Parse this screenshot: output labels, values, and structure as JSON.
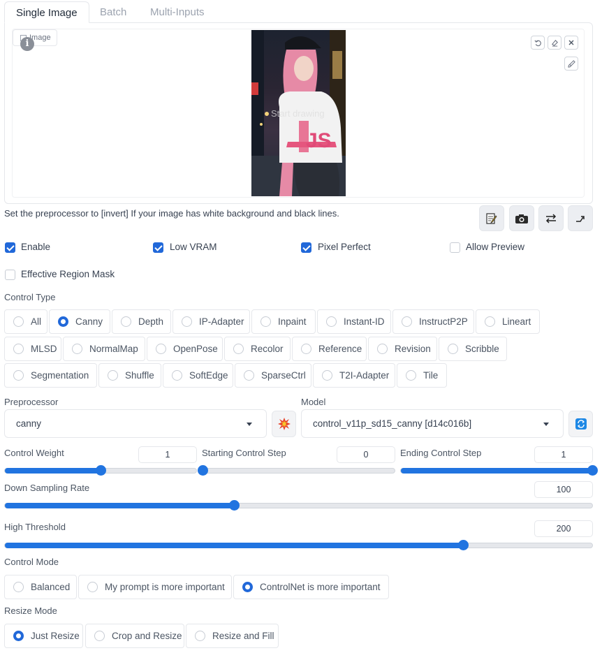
{
  "tabs": [
    {
      "label": "Single Image",
      "active": true
    },
    {
      "label": "Batch",
      "active": false
    },
    {
      "label": "Multi-Inputs",
      "active": false
    }
  ],
  "image_panel": {
    "image_label": "Image",
    "overlay_text": "Start drawing",
    "image_caption_letters": "JS"
  },
  "hint": "Set the preprocessor to [invert] If your image has white background and black lines.",
  "checkboxes": [
    {
      "label": "Enable",
      "checked": true
    },
    {
      "label": "Low VRAM",
      "checked": true
    },
    {
      "label": "Pixel Perfect",
      "checked": true
    },
    {
      "label": "Allow Preview",
      "checked": false
    },
    {
      "label": "Effective Region Mask",
      "checked": false
    }
  ],
  "control_type": {
    "label": "Control Type",
    "options": [
      "All",
      "Canny",
      "Depth",
      "IP-Adapter",
      "Inpaint",
      "Instant-ID",
      "InstructP2P",
      "Lineart",
      "MLSD",
      "NormalMap",
      "OpenPose",
      "Recolor",
      "Reference",
      "Revision",
      "Scribble",
      "Segmentation",
      "Shuffle",
      "SoftEdge",
      "SparseCtrl",
      "T2I-Adapter",
      "Tile"
    ],
    "selected": "Canny"
  },
  "preprocessor": {
    "label": "Preprocessor",
    "value": "canny"
  },
  "model": {
    "label": "Model",
    "value": "control_v11p_sd15_canny [d14c016b]"
  },
  "sliders": {
    "control_weight": {
      "label": "Control Weight",
      "value": "1",
      "fraction": 0.5
    },
    "starting_step": {
      "label": "Starting Control Step",
      "value": "0",
      "fraction": 0.0
    },
    "ending_step": {
      "label": "Ending Control Step",
      "value": "1",
      "fraction": 1.0
    },
    "down_sampling": {
      "label": "Down Sampling Rate",
      "value": "100",
      "fraction": 0.39
    },
    "high_threshold": {
      "label": "High Threshold",
      "value": "200",
      "fraction": 0.78
    }
  },
  "control_mode": {
    "label": "Control Mode",
    "options": [
      "Balanced",
      "My prompt is more important",
      "ControlNet is more important"
    ],
    "selected": "ControlNet is more important"
  },
  "resize_mode": {
    "label": "Resize Mode",
    "options": [
      "Just Resize",
      "Crop and Resize",
      "Resize and Fill"
    ],
    "selected": "Just Resize"
  },
  "colors": {
    "accent": "#2174e0",
    "checkbox": "#2168d9",
    "border": "#e5e7eb"
  },
  "icons": [
    "info-icon",
    "image-icon",
    "undo-icon",
    "eraser-icon",
    "close-icon",
    "brush-icon",
    "edit-canvas-icon",
    "camera-icon",
    "swap-icon",
    "send-dimensions-icon",
    "explosion-icon",
    "refresh-icon",
    "caret-down-icon"
  ]
}
